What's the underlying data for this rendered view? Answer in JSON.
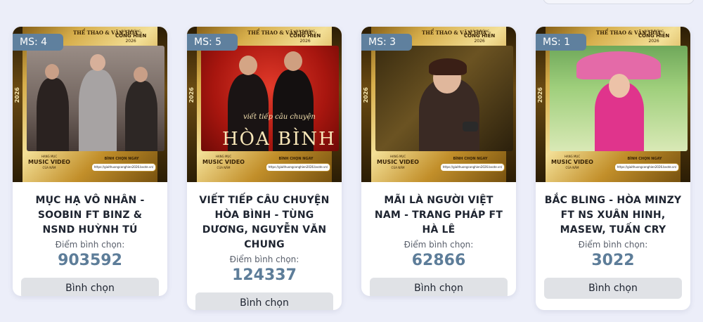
{
  "colors": {
    "accent": "#5f809e",
    "background": "#eceef9",
    "button": "#e0e2e6"
  },
  "thumbnail": {
    "brand": "THỂ THAO & VĂN HÓA",
    "award_small": "GIẢI THƯỞNG",
    "award_name": "CỐNG HIẾN",
    "award_year": "2026",
    "side_year": "2026",
    "category_small": "HẠNG MỤC",
    "category": "MUSIC VIDEO",
    "category_sub": "CỦA NĂM",
    "vote_now": "BÌNH CHỌN NGAY",
    "vote_url": "https://giaithuongconghien2026.bvote.vn/"
  },
  "score_label": "Điểm bình chọn:",
  "vote_label": "Bình chọn",
  "cards": [
    {
      "badge": "MS: 4",
      "title": "MỤC HẠ VÔ NHÂN - SOOBIN FT BINZ & NSND HUỲNH TÚ",
      "score": "903592"
    },
    {
      "badge": "MS: 5",
      "title": "VIẾT TIẾP CÂU CHUYỆN HÒA BÌNH - TÙNG DƯƠNG, NGUYỄN VĂN CHUNG",
      "score": "124337",
      "poster_title": "HÒA BÌNH",
      "poster_sub": "viết tiếp câu chuyện"
    },
    {
      "badge": "MS: 3",
      "title": "MÃI LÀ NGƯỜI VIỆT NAM - TRANG PHÁP FT HÀ LÊ",
      "score": "62866"
    },
    {
      "badge": "MS: 1",
      "title": "BẮC BLING - HÒA MINZY FT NS XUÂN HINH, MASEW, TUẤN CRY",
      "score": "3022"
    }
  ]
}
